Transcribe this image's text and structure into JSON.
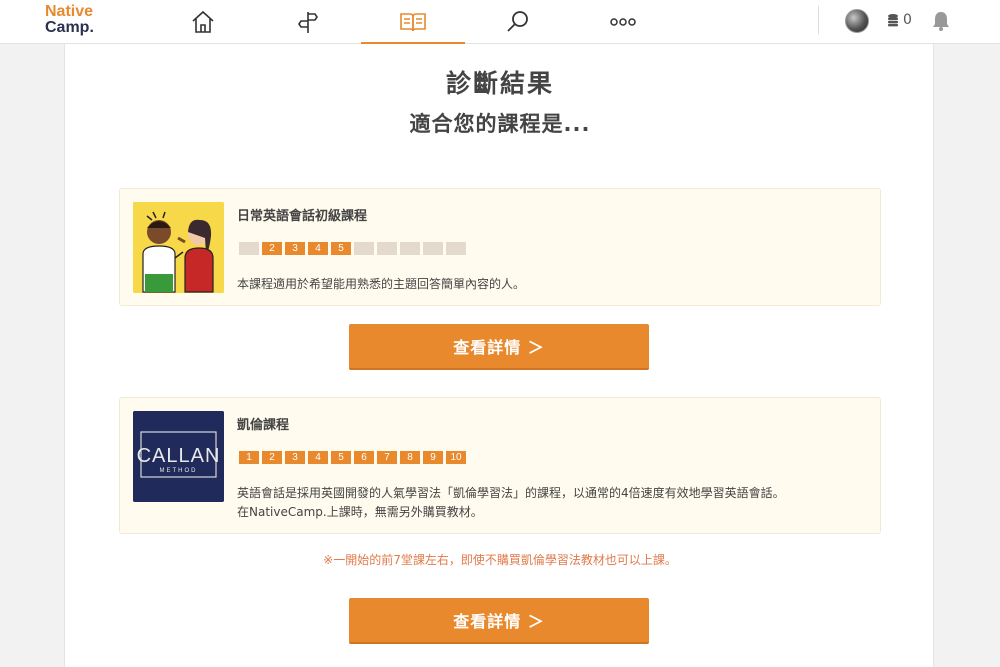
{
  "header": {
    "logo_line1": "Native",
    "logo_line2": "Camp.",
    "coin_count": "0",
    "nav": [
      {
        "icon": "home-icon"
      },
      {
        "icon": "signpost-icon"
      },
      {
        "icon": "book-icon",
        "active": true
      },
      {
        "icon": "search-icon"
      },
      {
        "icon": "more-icon"
      }
    ]
  },
  "main": {
    "title": "診斷結果",
    "subtitle": "適合您的課程是...",
    "courses": [
      {
        "name": "日常英語會話初級課程",
        "levels": [
          "",
          "2",
          "3",
          "4",
          "5",
          "",
          "",
          "",
          "",
          ""
        ],
        "active_levels": [
          2,
          3,
          4,
          5
        ],
        "description_lines": [
          "本課程適用於希望能用熟悉的主題回答簡單內容的人。"
        ],
        "button_label": "查看詳情 ＞"
      },
      {
        "name": "凱倫課程",
        "logo_text": "CALLAN",
        "logo_subtext": "METHOD",
        "levels": [
          "1",
          "2",
          "3",
          "4",
          "5",
          "6",
          "7",
          "8",
          "9",
          "10"
        ],
        "active_levels": [
          1,
          2,
          3,
          4,
          5,
          6,
          7,
          8,
          9,
          10
        ],
        "description_lines": [
          "英語會話是採用英國開發的人氣學習法「凱倫學習法」的課程，以通常的4倍速度有效地學習英語會話。",
          "在NativeCamp.上課時，無需另外購買教材。"
        ],
        "button_label": "查看詳情 ＞"
      }
    ],
    "note": "※一開始的前7堂課左右，即使不購買凱倫學習法教材也可以上課。"
  },
  "colors": {
    "accent": "#e8892d",
    "level_inactive": "#e3d9cc",
    "card_bg": "#fffbee",
    "note": "#e07a4a"
  }
}
